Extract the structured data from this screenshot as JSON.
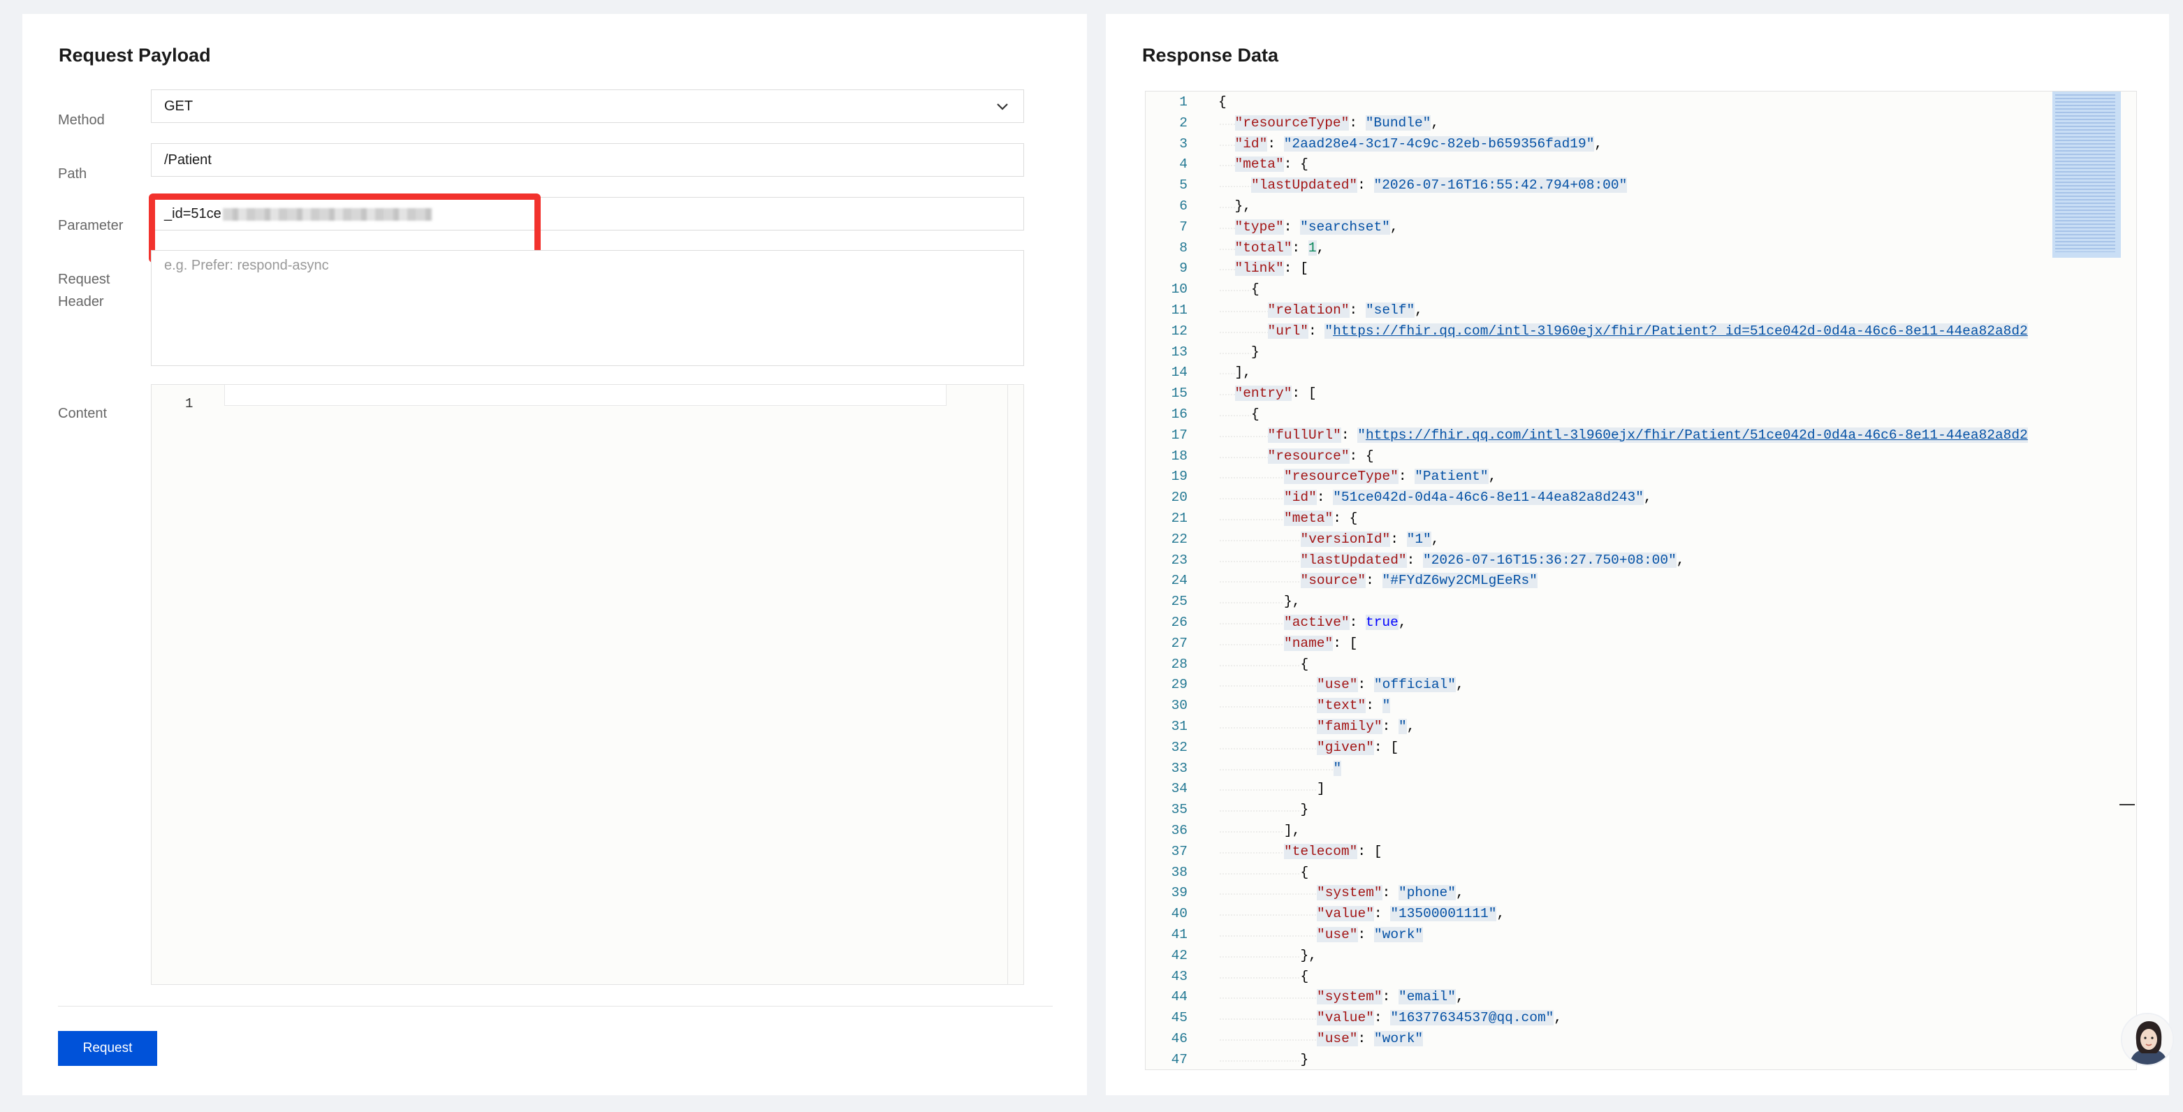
{
  "request": {
    "title": "Request Payload",
    "method_label": "Method",
    "method_value": "GET",
    "path_label": "Path",
    "path_value": "/Patient",
    "parameter_label": "Parameter",
    "parameter_value": "_id=51ce",
    "header_label_line1": "Request",
    "header_label_line2": "Header",
    "header_placeholder": "e.g. Prefer: respond-async",
    "content_label": "Content",
    "content_line_number": "1",
    "request_button": "Request"
  },
  "response": {
    "title": "Response Data",
    "code_lines": [
      {
        "n": "1",
        "i": 0,
        "parts": [
          [
            "p",
            "{"
          ]
        ]
      },
      {
        "n": "2",
        "i": 1,
        "parts": [
          [
            "k",
            "\"resourceType\""
          ],
          [
            "p",
            ": "
          ],
          [
            "s",
            "\"Bundle\""
          ],
          [
            "p",
            ","
          ]
        ]
      },
      {
        "n": "3",
        "i": 1,
        "parts": [
          [
            "k",
            "\"id\""
          ],
          [
            "p",
            ": "
          ],
          [
            "s",
            "\"2aad28e4-3c17-4c9c-82eb-b659356fad19\""
          ],
          [
            "p",
            ","
          ]
        ]
      },
      {
        "n": "4",
        "i": 1,
        "parts": [
          [
            "k",
            "\"meta\""
          ],
          [
            "p",
            ": {"
          ]
        ]
      },
      {
        "n": "5",
        "i": 2,
        "parts": [
          [
            "k",
            "\"lastUpdated\""
          ],
          [
            "p",
            ": "
          ],
          [
            "s",
            "\"2026-07-16T16:55:42.794+08:00\""
          ]
        ]
      },
      {
        "n": "6",
        "i": 1,
        "parts": [
          [
            "p",
            "},"
          ]
        ]
      },
      {
        "n": "7",
        "i": 1,
        "parts": [
          [
            "k",
            "\"type\""
          ],
          [
            "p",
            ": "
          ],
          [
            "s",
            "\"searchset\""
          ],
          [
            "p",
            ","
          ]
        ]
      },
      {
        "n": "8",
        "i": 1,
        "parts": [
          [
            "k",
            "\"total\""
          ],
          [
            "p",
            ": "
          ],
          [
            "n",
            "1"
          ],
          [
            "p",
            ","
          ]
        ]
      },
      {
        "n": "9",
        "i": 1,
        "parts": [
          [
            "k",
            "\"link\""
          ],
          [
            "p",
            ": ["
          ]
        ]
      },
      {
        "n": "10",
        "i": 2,
        "parts": [
          [
            "p",
            "{"
          ]
        ]
      },
      {
        "n": "11",
        "i": 3,
        "parts": [
          [
            "k",
            "\"relation\""
          ],
          [
            "p",
            ": "
          ],
          [
            "s",
            "\"self\""
          ],
          [
            "p",
            ","
          ]
        ]
      },
      {
        "n": "12",
        "i": 3,
        "parts": [
          [
            "k",
            "\"url\""
          ],
          [
            "p",
            ": "
          ],
          [
            "s",
            "\""
          ],
          [
            "link",
            "https://fhir.qq.com/intl-3l960ejx/fhir/Patient?_id=51ce042d-0d4a-46c6-8e11-44ea82a8d2"
          ]
        ]
      },
      {
        "n": "13",
        "i": 2,
        "parts": [
          [
            "p",
            "}"
          ]
        ]
      },
      {
        "n": "14",
        "i": 1,
        "parts": [
          [
            "p",
            "],"
          ]
        ]
      },
      {
        "n": "15",
        "i": 1,
        "parts": [
          [
            "k",
            "\"entry\""
          ],
          [
            "p",
            ": ["
          ]
        ]
      },
      {
        "n": "16",
        "i": 2,
        "parts": [
          [
            "p",
            "{"
          ]
        ]
      },
      {
        "n": "17",
        "i": 3,
        "parts": [
          [
            "k",
            "\"fullUrl\""
          ],
          [
            "p",
            ": "
          ],
          [
            "s",
            "\""
          ],
          [
            "link",
            "https://fhir.qq.com/intl-3l960ejx/fhir/Patient/51ce042d-0d4a-46c6-8e11-44ea82a8d2"
          ]
        ]
      },
      {
        "n": "18",
        "i": 3,
        "parts": [
          [
            "k",
            "\"resource\""
          ],
          [
            "p",
            ": {"
          ]
        ]
      },
      {
        "n": "19",
        "i": 4,
        "parts": [
          [
            "k",
            "\"resourceType\""
          ],
          [
            "p",
            ": "
          ],
          [
            "s",
            "\"Patient\""
          ],
          [
            "p",
            ","
          ]
        ]
      },
      {
        "n": "20",
        "i": 4,
        "parts": [
          [
            "k",
            "\"id\""
          ],
          [
            "p",
            ": "
          ],
          [
            "s",
            "\"51ce042d-0d4a-46c6-8e11-44ea82a8d243\""
          ],
          [
            "p",
            ","
          ]
        ]
      },
      {
        "n": "21",
        "i": 4,
        "parts": [
          [
            "k",
            "\"meta\""
          ],
          [
            "p",
            ": {"
          ]
        ]
      },
      {
        "n": "22",
        "i": 5,
        "parts": [
          [
            "k",
            "\"versionId\""
          ],
          [
            "p",
            ": "
          ],
          [
            "s",
            "\"1\""
          ],
          [
            "p",
            ","
          ]
        ]
      },
      {
        "n": "23",
        "i": 5,
        "parts": [
          [
            "k",
            "\"lastUpdated\""
          ],
          [
            "p",
            ": "
          ],
          [
            "s",
            "\"2026-07-16T15:36:27.750+08:00\""
          ],
          [
            "p",
            ","
          ]
        ]
      },
      {
        "n": "24",
        "i": 5,
        "parts": [
          [
            "k",
            "\"source\""
          ],
          [
            "p",
            ": "
          ],
          [
            "s",
            "\"#FYdZ6wy2CMLgEeRs\""
          ]
        ]
      },
      {
        "n": "25",
        "i": 4,
        "parts": [
          [
            "p",
            "},"
          ]
        ]
      },
      {
        "n": "26",
        "i": 4,
        "parts": [
          [
            "k",
            "\"active\""
          ],
          [
            "p",
            ": "
          ],
          [
            "b",
            "true"
          ],
          [
            "p",
            ","
          ]
        ]
      },
      {
        "n": "27",
        "i": 4,
        "parts": [
          [
            "k",
            "\"name\""
          ],
          [
            "p",
            ": ["
          ]
        ]
      },
      {
        "n": "28",
        "i": 5,
        "parts": [
          [
            "p",
            "{"
          ]
        ]
      },
      {
        "n": "29",
        "i": 6,
        "parts": [
          [
            "k",
            "\"use\""
          ],
          [
            "p",
            ": "
          ],
          [
            "s",
            "\"official\""
          ],
          [
            "p",
            ","
          ]
        ]
      },
      {
        "n": "30",
        "i": 6,
        "parts": [
          [
            "k",
            "\"text\""
          ],
          [
            "p",
            ": "
          ],
          [
            "s",
            "\""
          ]
        ]
      },
      {
        "n": "31",
        "i": 6,
        "parts": [
          [
            "k",
            "\"family\""
          ],
          [
            "p",
            ": "
          ],
          [
            "s",
            "\""
          ],
          [
            "p",
            ","
          ]
        ]
      },
      {
        "n": "32",
        "i": 6,
        "parts": [
          [
            "k",
            "\"given\""
          ],
          [
            "p",
            ": ["
          ]
        ]
      },
      {
        "n": "33",
        "i": 7,
        "parts": [
          [
            "s",
            "\""
          ]
        ]
      },
      {
        "n": "34",
        "i": 6,
        "parts": [
          [
            "p",
            "]"
          ]
        ]
      },
      {
        "n": "35",
        "i": 5,
        "parts": [
          [
            "p",
            "}"
          ]
        ]
      },
      {
        "n": "36",
        "i": 4,
        "parts": [
          [
            "p",
            "],"
          ]
        ]
      },
      {
        "n": "37",
        "i": 4,
        "parts": [
          [
            "k",
            "\"telecom\""
          ],
          [
            "p",
            ": ["
          ]
        ]
      },
      {
        "n": "38",
        "i": 5,
        "parts": [
          [
            "p",
            "{"
          ]
        ]
      },
      {
        "n": "39",
        "i": 6,
        "parts": [
          [
            "k",
            "\"system\""
          ],
          [
            "p",
            ": "
          ],
          [
            "s",
            "\"phone\""
          ],
          [
            "p",
            ","
          ]
        ]
      },
      {
        "n": "40",
        "i": 6,
        "parts": [
          [
            "k",
            "\"value\""
          ],
          [
            "p",
            ": "
          ],
          [
            "s",
            "\"13500001111\""
          ],
          [
            "p",
            ","
          ]
        ]
      },
      {
        "n": "41",
        "i": 6,
        "parts": [
          [
            "k",
            "\"use\""
          ],
          [
            "p",
            ": "
          ],
          [
            "s",
            "\"work\""
          ]
        ]
      },
      {
        "n": "42",
        "i": 5,
        "parts": [
          [
            "p",
            "},"
          ]
        ]
      },
      {
        "n": "43",
        "i": 5,
        "parts": [
          [
            "p",
            "{"
          ]
        ]
      },
      {
        "n": "44",
        "i": 6,
        "parts": [
          [
            "k",
            "\"system\""
          ],
          [
            "p",
            ": "
          ],
          [
            "s",
            "\"email\""
          ],
          [
            "p",
            ","
          ]
        ]
      },
      {
        "n": "45",
        "i": 6,
        "parts": [
          [
            "k",
            "\"value\""
          ],
          [
            "p",
            ": "
          ],
          [
            "s",
            "\"16377634537@qq.com\""
          ],
          [
            "p",
            ","
          ]
        ]
      },
      {
        "n": "46",
        "i": 6,
        "parts": [
          [
            "k",
            "\"use\""
          ],
          [
            "p",
            ": "
          ],
          [
            "s",
            "\"work\""
          ]
        ]
      },
      {
        "n": "47",
        "i": 5,
        "parts": [
          [
            "p",
            "}"
          ]
        ]
      }
    ]
  },
  "colors": {
    "accent": "#0052d9",
    "highlight_box": "#f2322d",
    "json_key": "#a31515",
    "json_string": "#0451a5",
    "json_number": "#098658",
    "json_boolean": "#0000ff",
    "line_number": "#237893"
  },
  "icons": {
    "method_dropdown": "chevron-down-icon",
    "assistant": "assistant-avatar-icon"
  }
}
